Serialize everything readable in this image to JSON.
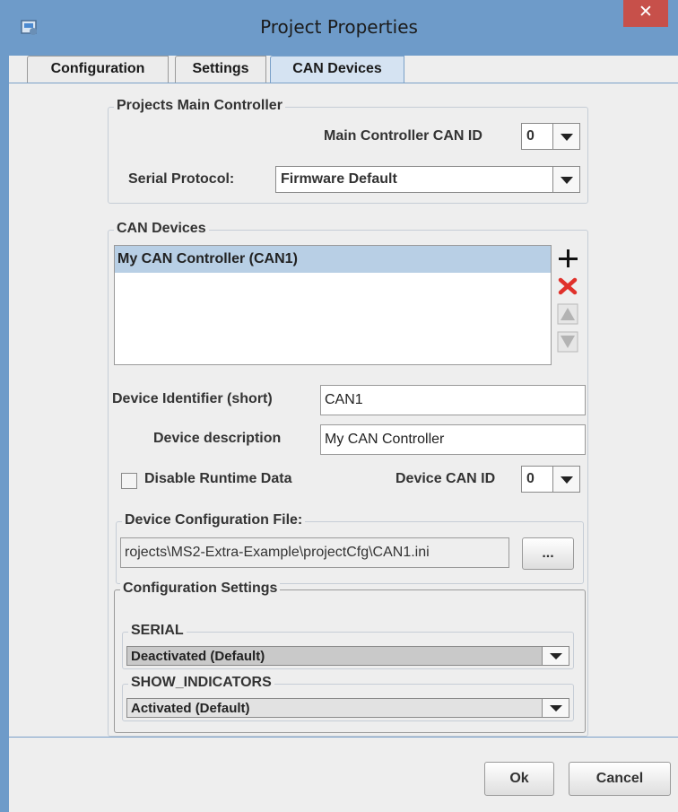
{
  "window": {
    "title": "Project Properties",
    "close_glyph": "✕"
  },
  "tabs": [
    {
      "label": "Configuration",
      "active": false
    },
    {
      "label": "Settings",
      "active": false
    },
    {
      "label": "CAN Devices",
      "active": true
    }
  ],
  "main_controller": {
    "group_title": "Projects Main Controller",
    "can_id_label": "Main Controller CAN ID",
    "can_id_value": "0",
    "serial_protocol_label": "Serial Protocol:",
    "serial_protocol_value": "Firmware Default"
  },
  "can_devices": {
    "group_title": "CAN Devices",
    "items": [
      {
        "label": "My CAN Controller (CAN1)",
        "selected": true
      }
    ],
    "buttons": {
      "add": "add-icon",
      "remove": "remove-icon",
      "move_up": "arrow-up-icon",
      "move_down": "arrow-down-icon"
    },
    "identifier_label": "Device Identifier (short)",
    "identifier_value": "CAN1",
    "description_label": "Device description",
    "description_value": "My CAN Controller",
    "disable_runtime_label": "Disable Runtime Data",
    "disable_runtime_checked": false,
    "device_can_id_label": "Device CAN ID",
    "device_can_id_value": "0",
    "config_file_title": "Device Configuration File:",
    "config_file_value": "rojects\\MS2-Extra-Example\\projectCfg\\CAN1.ini",
    "browse_label": "..."
  },
  "config_settings": {
    "group_title": "Configuration Settings",
    "settings": [
      {
        "name": "SERIAL",
        "value": "Deactivated (Default)"
      },
      {
        "name": "SHOW_INDICATORS",
        "value": "Activated (Default)"
      }
    ]
  },
  "footer": {
    "ok_label": "Ok",
    "cancel_label": "Cancel"
  },
  "colors": {
    "title_bar": "#6e9bc9",
    "close_button": "#c7504a",
    "selection": "#b8cfe5",
    "remove_icon": "#e0312b"
  }
}
